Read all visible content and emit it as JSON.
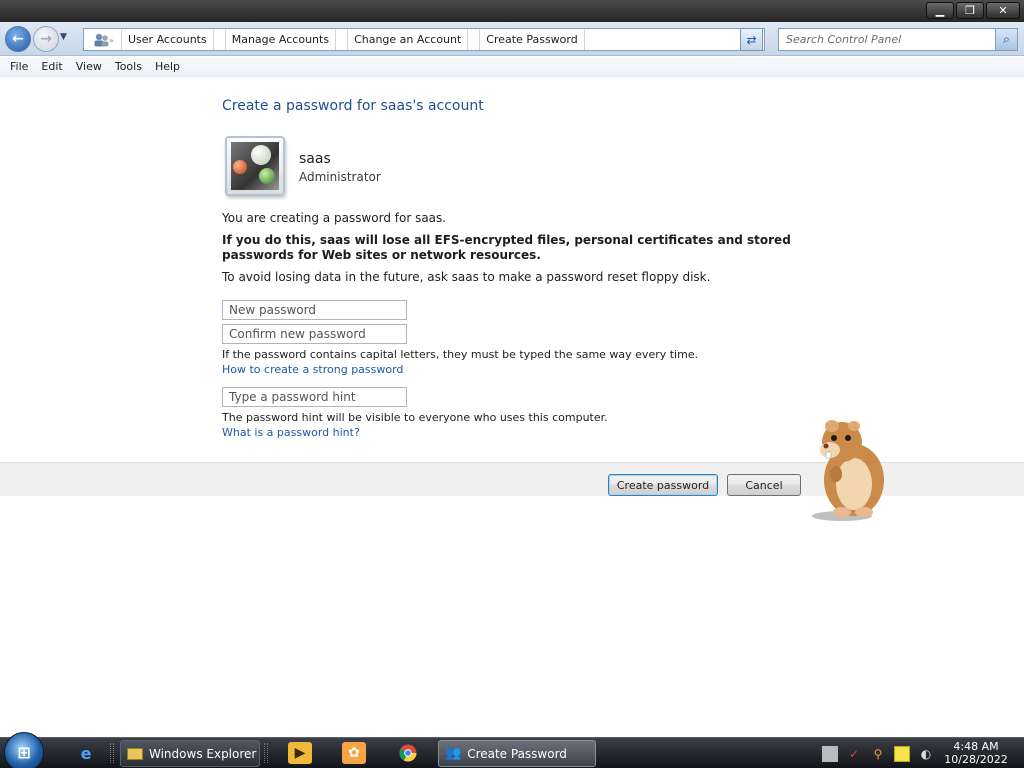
{
  "window": {
    "minimize": "▁",
    "maximize": "❐",
    "close": "✕"
  },
  "addressbar": {
    "crumbs": [
      "User Accounts",
      "Manage Accounts",
      "Change an Account",
      "Create Password"
    ],
    "search_placeholder": "Search Control Panel"
  },
  "menu": [
    "File",
    "Edit",
    "View",
    "Tools",
    "Help"
  ],
  "page": {
    "title": "Create a password for saas's account",
    "user_name": "saas",
    "user_role": "Administrator",
    "intro": "You are creating a password for saas.",
    "warning": "If you do this, saas will lose all EFS-encrypted files, personal certificates and stored passwords for Web sites or network resources.",
    "advice": "To avoid losing data in the future, ask saas to make a password reset floppy disk.",
    "new_password_placeholder": "New password",
    "confirm_password_placeholder": "Confirm new password",
    "case_note": "If the password contains capital letters, they must be typed the same way every time.",
    "strong_link": "How to create a strong password",
    "hint_placeholder": "Type a password hint",
    "hint_note": "The password hint will be visible to everyone who uses this computer.",
    "hint_link": "What is a password hint?"
  },
  "buttons": {
    "create": "Create password",
    "cancel": "Cancel"
  },
  "taskbar": {
    "start": "⊞",
    "tasks": [
      {
        "label": "Windows Explorer"
      },
      {
        "label": "Create Password"
      }
    ],
    "clock_time": "4:48 AM",
    "clock_date": "10/28/2022"
  }
}
